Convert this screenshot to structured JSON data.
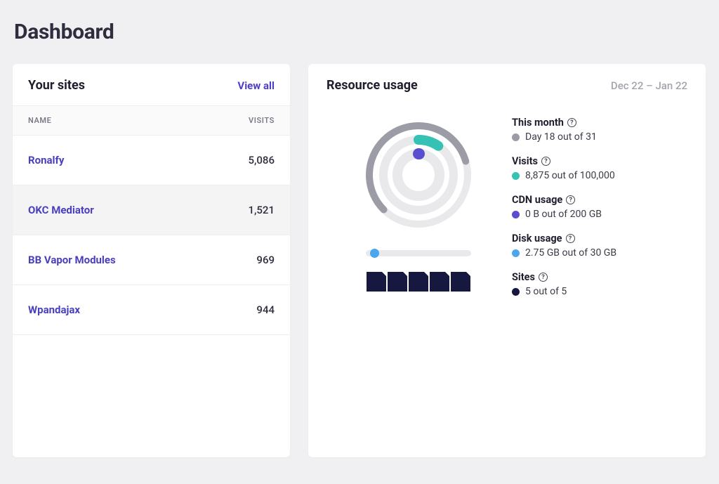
{
  "page": {
    "title": "Dashboard"
  },
  "sites_card": {
    "title": "Your sites",
    "view_all": "View all",
    "col_name": "NAME",
    "col_visits": "VISITS",
    "rows": [
      {
        "name": "Ronalfy",
        "visits": "5,086"
      },
      {
        "name": "OKC Mediator",
        "visits": "1,521"
      },
      {
        "name": "BB Vapor Modules",
        "visits": "969"
      },
      {
        "name": "Wpandajax",
        "visits": "944"
      }
    ]
  },
  "usage_card": {
    "title": "Resource usage",
    "range": "Dec 22 – Jan 22",
    "colors": {
      "month": "#9c9ca6",
      "visits": "#36c1b5",
      "cdn": "#5a4ed0",
      "disk": "#4aa7ef",
      "sites": "#171840"
    },
    "month": {
      "label": "This month",
      "value": "Day 18 out of 31"
    },
    "visits": {
      "label": "Visits",
      "value": "8,875 out of 100,000"
    },
    "cdn": {
      "label": "CDN usage",
      "value": "0 B out of 200 GB"
    },
    "disk": {
      "label": "Disk usage",
      "value": "2.75 GB out of 30 GB"
    },
    "sites": {
      "label": "Sites",
      "value": "5 out of 5"
    }
  },
  "chart_data": {
    "type": "radial-multi",
    "series": [
      {
        "name": "This month",
        "value": 18,
        "max": 31,
        "percent": 58.1
      },
      {
        "name": "Visits",
        "value": 8875,
        "max": 100000,
        "percent": 8.9
      },
      {
        "name": "CDN usage",
        "value": 0,
        "max": 200,
        "unit": "GB",
        "percent": 0
      }
    ],
    "disk": {
      "value": 2.75,
      "max": 30,
      "unit": "GB",
      "percent": 9.2
    },
    "sites": {
      "value": 5,
      "max": 5,
      "percent": 100
    }
  }
}
